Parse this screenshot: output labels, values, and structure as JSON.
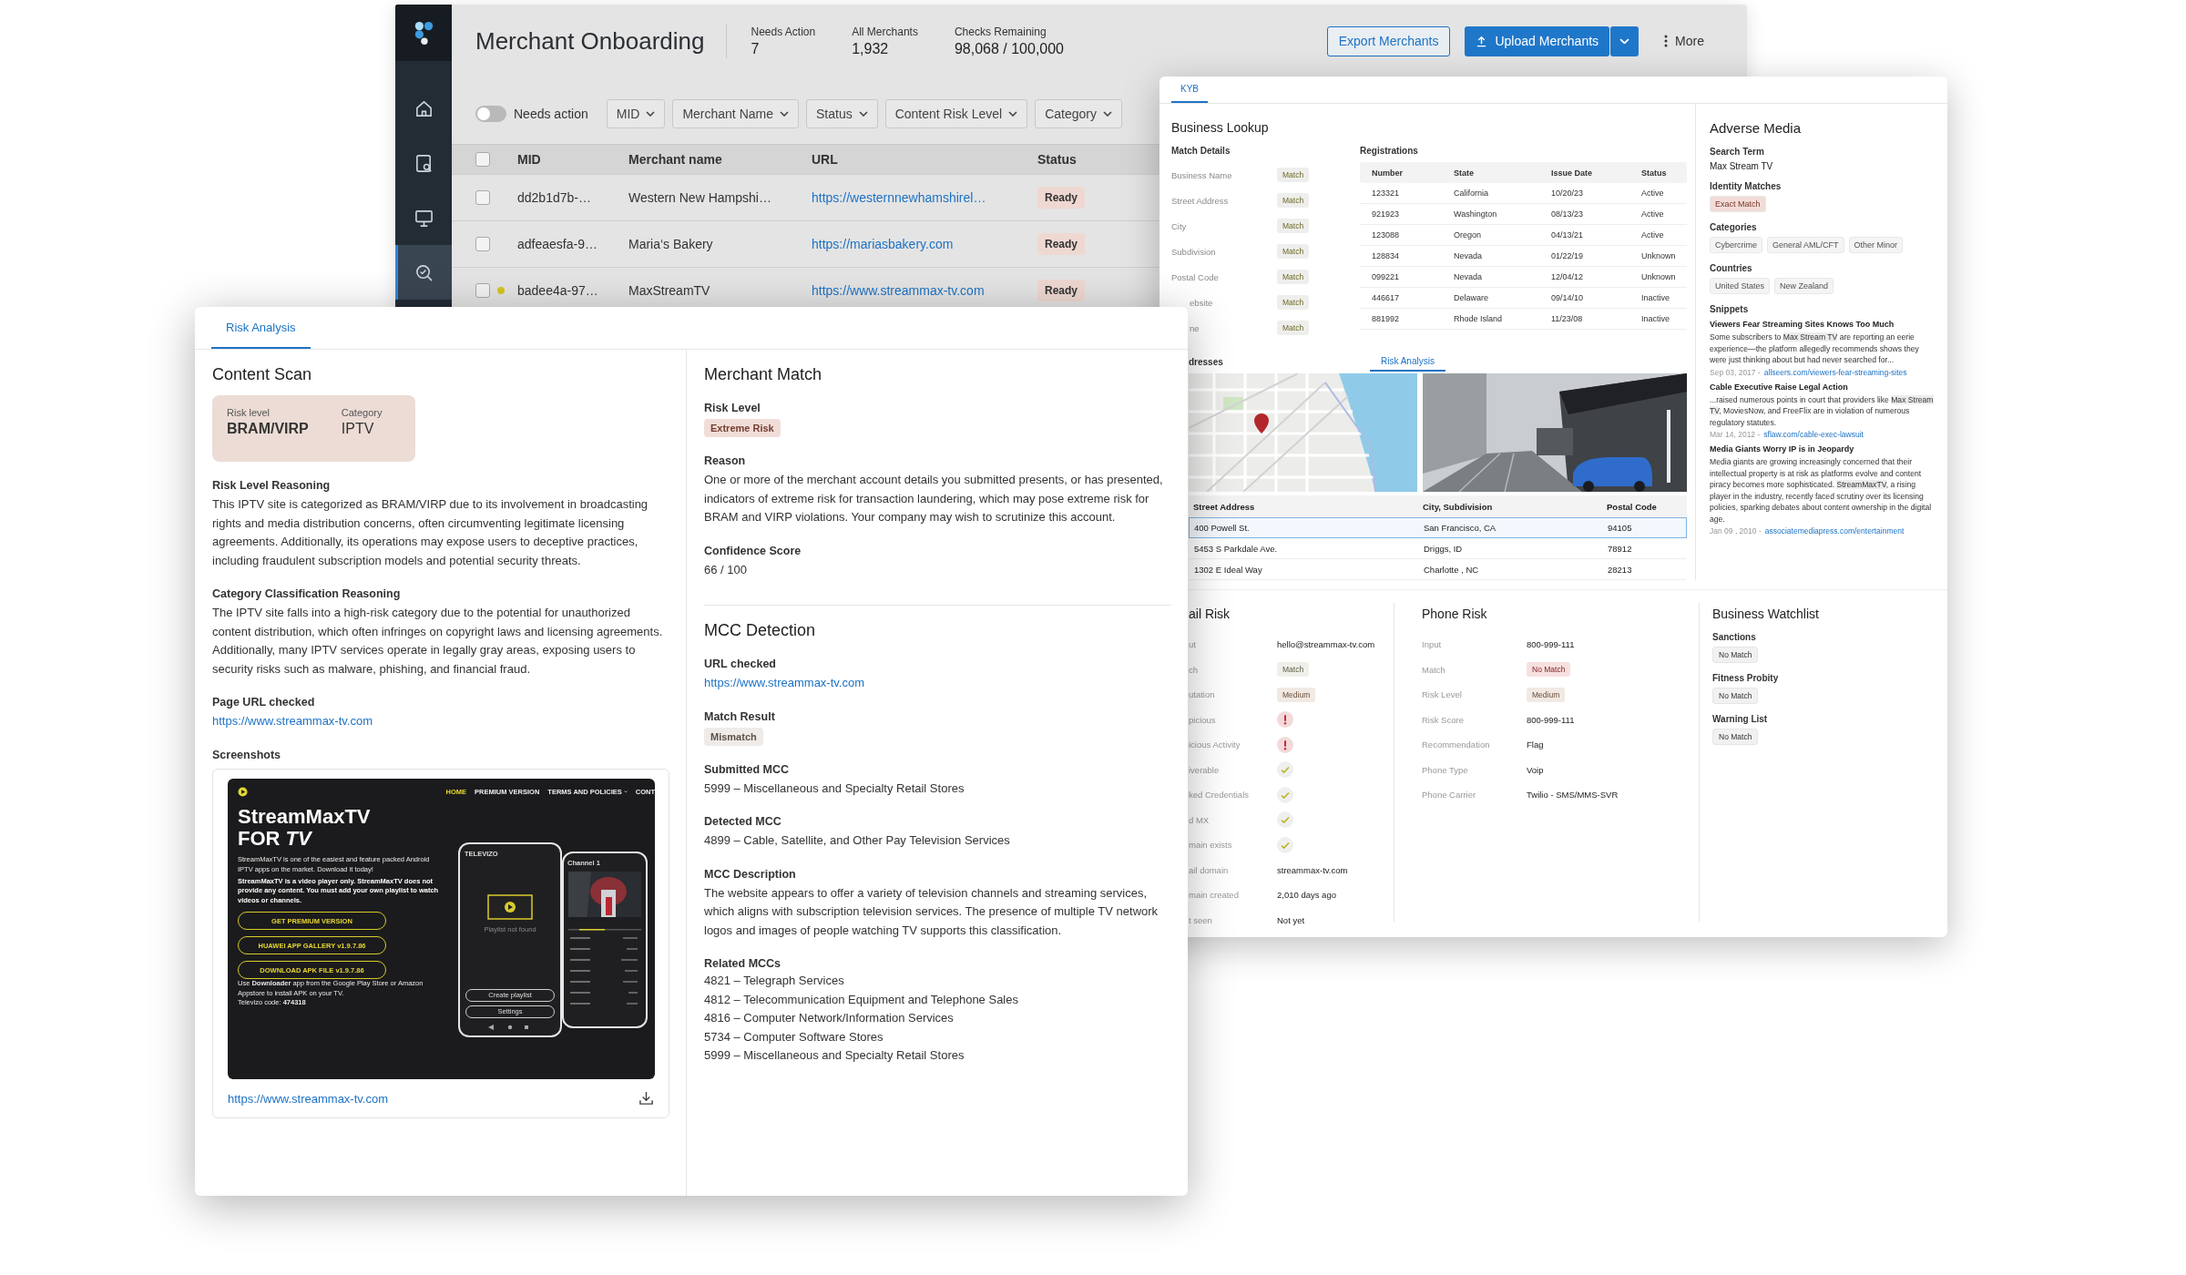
{
  "onboarding": {
    "title": "Merchant Onboarding",
    "stats": [
      {
        "label": "Needs Action",
        "value": "7"
      },
      {
        "label": "All Merchants",
        "value": "1,932"
      },
      {
        "label": "Checks Remaining",
        "value": "98,068 / 100,000"
      }
    ],
    "buttons": [
      {
        "kind": "export",
        "label": "Export Merchants"
      },
      {
        "kind": "upload",
        "label": "Upload Merchants"
      },
      {
        "kind": "more",
        "label": "More"
      }
    ],
    "nav": [
      {
        "kind": "home",
        "selected": false
      },
      {
        "kind": "doc-search",
        "selected": false
      },
      {
        "kind": "monitor",
        "selected": false
      },
      {
        "kind": "search-check",
        "selected": true
      }
    ],
    "needs_action": {
      "label": "Needs action",
      "on": false
    },
    "filters": [
      "MID",
      "Merchant Name",
      "Status",
      "Content Risk Level",
      "Category"
    ],
    "table": {
      "header_checked": false,
      "columns": [
        "MID",
        "Merchant name",
        "URL",
        "Status"
      ],
      "rows": [
        {
          "checked": false,
          "flagged": false,
          "mid": "dd2b1d7b-…",
          "name": "Western New Hampshi…",
          "url": "https://westernnewhamshirel…",
          "status": "Ready"
        },
        {
          "checked": false,
          "flagged": false,
          "mid": "adfeaesfa-9…",
          "name": "Maria‘s Bakery",
          "url": "https://mariasbakery.com",
          "status": "Ready"
        },
        {
          "checked": false,
          "flagged": true,
          "mid": "badee4a-97…",
          "name": "MaxStreamTV",
          "url": "https://www.streammax-tv.com",
          "status": "Ready"
        }
      ]
    }
  },
  "kyb": {
    "tabs": [
      {
        "label": "KYB",
        "selected": true
      }
    ],
    "business_lookup": {
      "title": "Business Lookup",
      "match_details": {
        "title": "Match Details",
        "rows": [
          {
            "label": "Business Name",
            "result": "Match"
          },
          {
            "label": "Street Address",
            "result": "Match"
          },
          {
            "label": "City",
            "result": "Match"
          },
          {
            "label": "Subdivision",
            "result": "Match"
          },
          {
            "label": "Postal Code",
            "result": "Match"
          },
          {
            "label": "ebsite",
            "result": "Match"
          },
          {
            "label": "ne",
            "result": "Match"
          }
        ]
      },
      "registrations": {
        "title": "Registrations",
        "columns": [
          "Number",
          "State",
          "Issue Date",
          "Status"
        ],
        "rows": [
          [
            "123321",
            "California",
            "10/20/23",
            "Active"
          ],
          [
            "921923",
            "Washington",
            "08/13/23",
            "Active"
          ],
          [
            "123088",
            "Oregon",
            "04/13/21",
            "Active"
          ],
          [
            "128834",
            "Nevada",
            "01/22/19",
            "Unknown"
          ],
          [
            "099221",
            "Nevada",
            "12/04/12",
            "Unknown"
          ],
          [
            "446617",
            "Delaware",
            "09/14/10",
            "Inactive"
          ],
          [
            "881992",
            "Rhode Island",
            "11/23/08",
            "Inactive"
          ]
        ]
      }
    },
    "addresses": {
      "title": "dresses",
      "tabs": [
        {
          "label": "Risk Analysis",
          "selected": true
        }
      ],
      "columns": [
        "Street Address",
        "City, Subdivision",
        "Postal Code"
      ],
      "rows": [
        {
          "selected": true,
          "cells": [
            "400 Powell St.",
            "San Francisco, CA",
            "94105"
          ]
        },
        {
          "selected": false,
          "cells": [
            "5453 S Parkdale Ave.",
            "Driggs, ID",
            "78912"
          ]
        },
        {
          "selected": false,
          "cells": [
            "1302 E Ideal Way",
            "Charlotte , NC",
            "28213"
          ]
        }
      ]
    },
    "adverse_media": {
      "title": "Adverse Media",
      "search_term_label": "Search Term",
      "search_term": "Max Stream TV",
      "groups": [
        {
          "label": "Identity Matches",
          "tags": [
            {
              "text": "Exact Match",
              "color": "#f2dcd7"
            }
          ]
        },
        {
          "label": "Categories",
          "tags": [
            {
              "text": "Cybercrime",
              "color": "#f4f4f4"
            },
            {
              "text": "General AML/CFT",
              "color": "#f4f4f4"
            },
            {
              "text": "Other Minor",
              "color": "#f4f4f4"
            }
          ]
        },
        {
          "label": "Countries",
          "tags": [
            {
              "text": "United States",
              "color": "#f4f4f4"
            },
            {
              "text": "New Zealand",
              "color": "#f4f4f4"
            }
          ]
        }
      ],
      "snippets_label": "Snippets",
      "snippets": [
        {
          "title": "Viewers Fear Streaming Sites Knows Too Much",
          "text": "Some subscribers to **Max Stream TV** are reporting an eerie experience—the platform allegedly recommends shows they were just thinking about but had never searched for...",
          "date": "Sep 03, 2017 -",
          "link": "allseers.com/viewers-fear-streaming-sites"
        },
        {
          "title": "Cable Executive Raise Legal Action",
          "text": "...raised numerous points in court that providers like **Max Stream TV**, MoviesNow, and FreeFlix are in violation of numerous regulatory statutes.",
          "date": "Mar 14, 2012 -",
          "link": "sflaw.com/cable-exec-lawsuit"
        },
        {
          "title": "Media Giants Worry IP is in Jeopardy",
          "text": "Media giants are growing increasingly concerned that their intellectual property is at risk as platforms evolve and content piracy becomes more sophisticated. **StreamMaxTV**, a rising player in the industry, recently faced scrutiny over its licensing policies, sparking debates about content ownership in the digital age.",
          "date": "Jan 09 , 2010 -",
          "link": "associatemediapress.com/entertainment"
        }
      ]
    },
    "email_risk": {
      "title": "ail Risk",
      "rows": [
        {
          "label": "ut",
          "kind": "text",
          "value": "hello@streammax-tv.com"
        },
        {
          "label": "ch",
          "kind": "badge",
          "value": "Match",
          "color": "#f0f0ea"
        },
        {
          "label": "utation",
          "kind": "badge",
          "value": "Medium",
          "color": "#f1e9e3"
        },
        {
          "label": "picious",
          "kind": "alert"
        },
        {
          "label": "icious Activity",
          "kind": "alert"
        },
        {
          "label": "iverable",
          "kind": "check"
        },
        {
          "label": "ked Credentials",
          "kind": "check"
        },
        {
          "label": "d MX",
          "kind": "check"
        },
        {
          "label": "main exists",
          "kind": "check"
        },
        {
          "label": "ail domain",
          "kind": "text",
          "value": "streammax-tv.com"
        },
        {
          "label": "main created",
          "kind": "text",
          "value": "2,010 days ago"
        },
        {
          "label": "t seen",
          "kind": "text",
          "value": "Not yet"
        }
      ]
    },
    "phone_risk": {
      "title": "Phone Risk",
      "rows": [
        {
          "label": "Input",
          "kind": "text",
          "value": "800-999-111"
        },
        {
          "label": "Match",
          "kind": "badge",
          "value": "No Match",
          "color": "#f8e0e0"
        },
        {
          "label": "Risk Level",
          "kind": "badge",
          "value": "Medium",
          "color": "#f1e9e3"
        },
        {
          "label": "Risk Score",
          "kind": "text",
          "value": "800-999-111"
        },
        {
          "label": "Recommendation",
          "kind": "text",
          "value": "Flag"
        },
        {
          "label": "Phone Type",
          "kind": "text",
          "value": "Voip"
        },
        {
          "label": "Phone Carrier",
          "kind": "text",
          "value": "Twilio - SMS/MMS-SVR"
        }
      ]
    },
    "watchlist": {
      "title": "Business Watchlist",
      "items": [
        {
          "label": "Sanctions",
          "result": "No Match"
        },
        {
          "label": "Fitness Probity",
          "result": "No Match"
        },
        {
          "label": "Warning List",
          "result": "No Match"
        }
      ]
    }
  },
  "risk_analysis": {
    "tabs": [
      {
        "label": "Risk Analysis",
        "selected": true
      }
    ],
    "content_scan": {
      "title": "Content Scan",
      "summary": [
        {
          "label": "Risk level",
          "value": "BRAM/VIRP"
        },
        {
          "label": "Category",
          "value": "IPTV"
        }
      ],
      "sections": [
        {
          "heading": "Risk Level Reasoning",
          "kind": "text",
          "text": "This IPTV site is categorized as BRAM/VIRP due to its involvement in broadcasting rights and media distribution concerns, often circumventing legitimate licensing agreements. Additionally, its operations may expose users to deceptive practices, including fraudulent subscription models and potential security threats."
        },
        {
          "heading": "Category Classification Reasoning",
          "kind": "text",
          "text": "The IPTV site falls into a high-risk category due to the potential for unauthorized content distribution, which often infringes on copyright laws and licensing agreements. Additionally, many IPTV services operate in legally gray areas, exposing users to security risks such as malware, phishing, and financial fraud."
        },
        {
          "heading": "Page URL checked",
          "kind": "link",
          "text": "https://www.streammax-tv.com"
        }
      ],
      "screenshots": {
        "heading": "Screenshots",
        "url": "https://www.streammax-tv.com",
        "site": {
          "nav": [
            {
              "label": "HOME",
              "selected": true,
              "menu": false
            },
            {
              "label": "PREMIUM VERSION",
              "selected": false,
              "menu": false
            },
            {
              "label": "TERMS AND POLICIES",
              "selected": false,
              "menu": true
            },
            {
              "label": "CONT",
              "selected": false,
              "menu": false
            }
          ],
          "title_lines": [
            "StreamMaxTV",
            "FOR *TV*"
          ],
          "intro": "StreamMaxTV is one of the easiest and feature packed Android IPTV apps on the market. Download it today!",
          "notice": "StreamMaxTV is a video player only. StreamMaxTV does not provide any content. You must add your own playlist to watch videos or channels.",
          "buttons": [
            "GET PREMIUM VERSION",
            "HUAWEI APP GALLERY v1.9.7.86",
            "DOWNLOAD APK FILE v1.9.7.86"
          ],
          "footer": [
            "Use **Downloader** app from the Google Play Store or Amazon Appstore to install APK on your TV.",
            "Televizo code: **474318**"
          ],
          "phones": [
            {
              "kind": "home",
              "title": "TELEVIZO",
              "message": "Playlist not found",
              "buttons": [
                "Create playlist",
                "Settings"
              ]
            },
            {
              "kind": "player",
              "title": "Channel 1"
            }
          ]
        }
      }
    },
    "merchant_match": {
      "title": "Merchant Match",
      "fields": [
        {
          "label": "Risk Level",
          "kind": "badge",
          "value": "Extreme Risk",
          "color": "#f1ddd8"
        },
        {
          "label": "Reason",
          "kind": "text",
          "value": "One or more of the merchant account details you submitted presents, or has presented, indicators of extreme risk for transaction laundering, which may pose extreme risk for BRAM and VIRP violations. Your company may wish to scrutinize this account."
        },
        {
          "label": "Confidence Score",
          "kind": "text",
          "value": "66 / 100"
        }
      ]
    },
    "mcc_detection": {
      "title": "MCC Detection",
      "fields": [
        {
          "label": "URL checked",
          "kind": "link",
          "value": "https://www.streammax-tv.com"
        },
        {
          "label": "Match Result",
          "kind": "badge",
          "value": "Mismatch",
          "color": "#efebe8"
        },
        {
          "label": "Submitted MCC",
          "kind": "text",
          "value": "5999 – Miscellaneous and Specialty Retail Stores"
        },
        {
          "label": "Detected MCC",
          "kind": "text",
          "value": "4899 – Cable, Satellite, and Other Pay Television Services"
        },
        {
          "label": "MCC Description",
          "kind": "text",
          "value": "The website appears to offer a variety of television channels and streaming services, which aligns with subscription television services. The presence of multiple TV network logos and images of people watching TV supports this classification."
        },
        {
          "label": "Related MCCs",
          "kind": "list",
          "values": [
            "4821 – Telegraph Services",
            "4812 – Telecommunication Equipment and Telephone Sales",
            "4816 – Computer Network/Information Services",
            "5734 – Computer Software Stores",
            "5999 – Miscellaneous and Specialty Retail Stores"
          ]
        }
      ]
    }
  }
}
